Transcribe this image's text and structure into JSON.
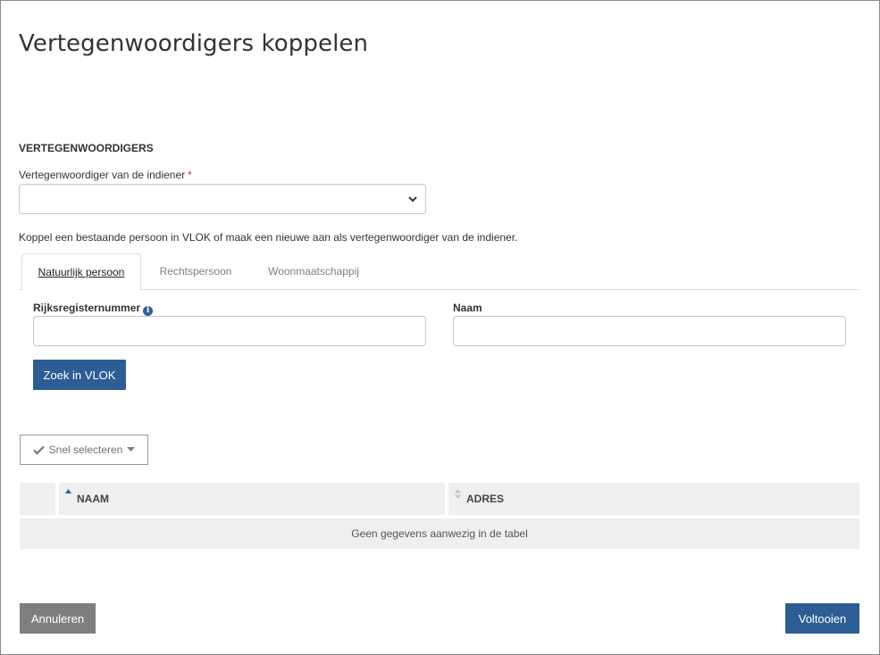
{
  "dialog": {
    "title": "Vertegenwoordigers koppelen"
  },
  "section": {
    "heading": "VERTEGENWOORDIGERS",
    "select_label": "Vertegenwoordiger van de indiener",
    "required_marker": "*",
    "select_value": "",
    "help_text": "Koppel een bestaande persoon in VLOK of maak een nieuwe aan als vertegenwoordiger van de indiener."
  },
  "tabs": [
    {
      "label": "Natuurlijk persoon",
      "active": true
    },
    {
      "label": "Rechtspersoon",
      "active": false
    },
    {
      "label": "Woonmaatschappij",
      "active": false
    }
  ],
  "search": {
    "rrn_label": "Rijksregisternummer",
    "rrn_value": "",
    "name_label": "Naam",
    "name_value": "",
    "button_label": "Zoek in VLOK"
  },
  "quick_select": {
    "label": "Snel selecteren"
  },
  "table": {
    "columns": [
      "NAAM",
      "ADRES"
    ],
    "sort_column": "NAAM",
    "empty_message": "Geen gegevens aanwezig in de tabel"
  },
  "footer": {
    "cancel_label": "Annuleren",
    "finish_label": "Voltooien"
  },
  "colors": {
    "primary": "#2c5e95",
    "secondary": "#7f7f7f",
    "required": "#c0392b"
  },
  "icons": [
    "chevron-down-icon",
    "info-icon",
    "check-icon",
    "caret-down-icon",
    "sort-asc-icon",
    "sort-icon"
  ]
}
